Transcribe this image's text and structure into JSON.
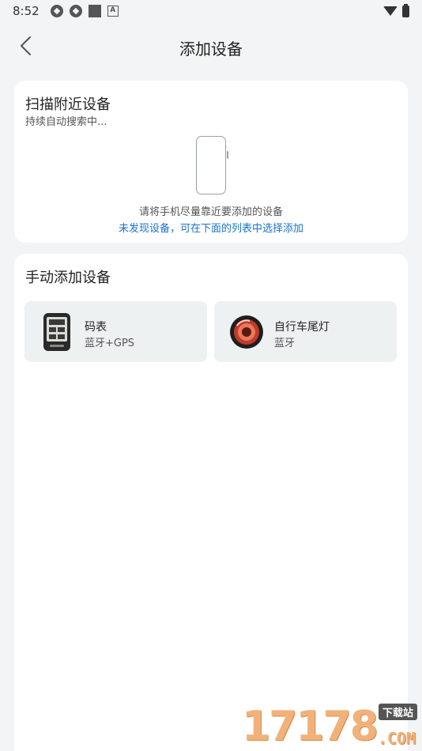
{
  "status_bar": {
    "time": "8:52"
  },
  "header": {
    "title": "添加设备"
  },
  "scan": {
    "title": "扫描附近设备",
    "subtitle": "持续自动搜索中...",
    "hint": "请将手机尽量靠近要添加的设备",
    "link": "未发现设备，可在下面的列表中选择添加"
  },
  "manual": {
    "title": "手动添加设备",
    "devices": [
      {
        "name": "码表",
        "type": "蓝牙+GPS",
        "icon": "bike-computer-icon"
      },
      {
        "name": "自行车尾灯",
        "type": "蓝牙",
        "icon": "tail-light-icon"
      }
    ]
  },
  "watermark": {
    "digits": "17178",
    "tag": "下载站",
    "suffix": ".COM"
  },
  "colors": {
    "link": "#1a73c8",
    "background": "#f2f4f5",
    "tile": "#eef1f2"
  }
}
